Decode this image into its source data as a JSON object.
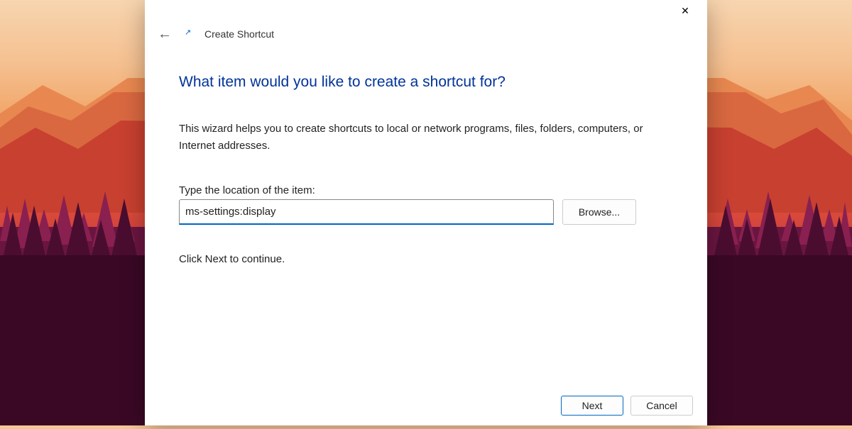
{
  "header": {
    "wizard_title": "Create Shortcut"
  },
  "main": {
    "heading": "What item would you like to create a shortcut for?",
    "description": "This wizard helps you to create shortcuts to local or network programs, files, folders, computers, or Internet addresses.",
    "field_label": "Type the location of the item:",
    "location_value": "ms-settings:display",
    "browse_label": "Browse...",
    "continue_text": "Click Next to continue."
  },
  "footer": {
    "next_label": "Next",
    "cancel_label": "Cancel"
  }
}
